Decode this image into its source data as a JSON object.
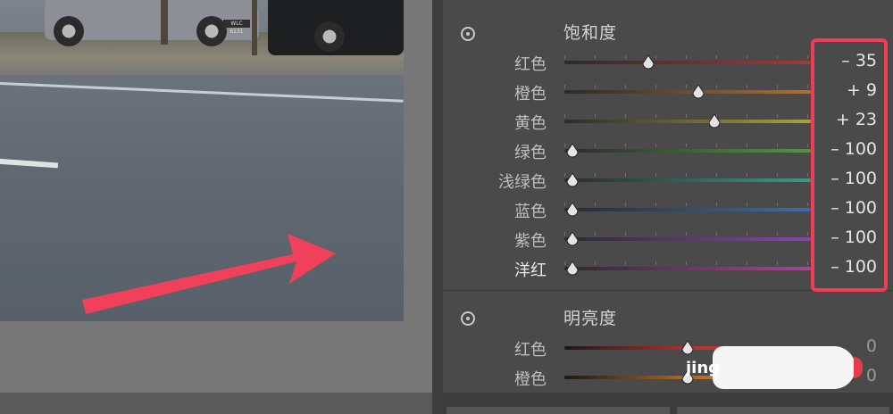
{
  "photo": {
    "plate_text": "WLC 6131"
  },
  "panel": {
    "saturation": {
      "title": "饱和度",
      "rows": [
        {
          "label": "红色",
          "value": "– 35",
          "level": -35
        },
        {
          "label": "橙色",
          "value": "+ 9",
          "level": 9
        },
        {
          "label": "黄色",
          "value": "+ 23",
          "level": 23
        },
        {
          "label": "绿色",
          "value": "– 100",
          "level": -100
        },
        {
          "label": "浅绿色",
          "value": "– 100",
          "level": -100
        },
        {
          "label": "蓝色",
          "value": "– 100",
          "level": -100
        },
        {
          "label": "紫色",
          "value": "– 100",
          "level": -100
        },
        {
          "label": "洋红",
          "value": "– 100",
          "level": -100
        }
      ]
    },
    "luminance": {
      "title": "明亮度",
      "rows": [
        {
          "label": "红色",
          "value": "0",
          "level": 0
        },
        {
          "label": "橙色",
          "value": "0",
          "level": 0
        }
      ]
    }
  },
  "watermark": {
    "text": "jing"
  },
  "colors": {
    "highlight": "#ef3d55",
    "arrow": "#f0405a",
    "panel_bg": "#4a4a4a"
  },
  "icons": {
    "section_target": "target-icon",
    "slider_thumb": "teardrop-icon"
  }
}
